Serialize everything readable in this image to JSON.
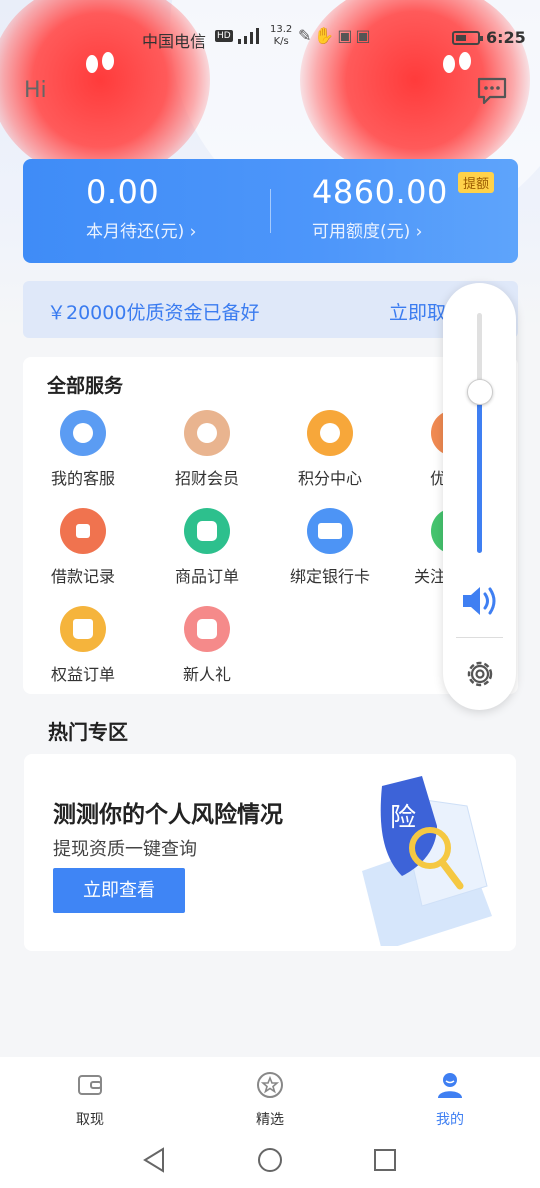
{
  "status_bar": {
    "carrier": "中国电信",
    "hd": "HD",
    "speed_value": "13.2",
    "speed_unit": "K/s",
    "time": "6:25"
  },
  "header": {
    "greeting": "Hi"
  },
  "balance": {
    "due_value": "0.00",
    "due_label": "本月待还(元) ",
    "credit_value": "4860.00",
    "credit_label": "可用额度(元) ",
    "badge": "提额"
  },
  "promo": {
    "text": "￥20000优质资金已备好",
    "action": "立即取现"
  },
  "services": {
    "title": "全部服务",
    "items": [
      {
        "label": "我的客服",
        "color": "#5b9cf3"
      },
      {
        "label": "招财会员",
        "color": "#e9b48f"
      },
      {
        "label": "积分中心",
        "color": "#f7a73a"
      },
      {
        "label": "优惠券",
        "color": "#f08a52"
      },
      {
        "label": "借款记录",
        "color": "#f0734f"
      },
      {
        "label": "商品订单",
        "color": "#2dc08d"
      },
      {
        "label": "绑定银行卡",
        "color": "#4d94f5"
      },
      {
        "label": "关注公众号",
        "color": "#45c46e"
      },
      {
        "label": "权益订单",
        "color": "#f5b43c"
      },
      {
        "label": "新人礼",
        "color": "#f58a8a"
      }
    ]
  },
  "hot": {
    "title": "热门专区",
    "card_title": "测测你的个人风险情况",
    "card_sub": "提现资质一键查询",
    "card_button": "立即查看",
    "illus_text": "险"
  },
  "volume": {
    "level_fraction": 0.67
  },
  "bottom_nav": [
    {
      "label": "取现",
      "active": false
    },
    {
      "label": "精选",
      "active": false
    },
    {
      "label": "我的",
      "active": true
    }
  ]
}
